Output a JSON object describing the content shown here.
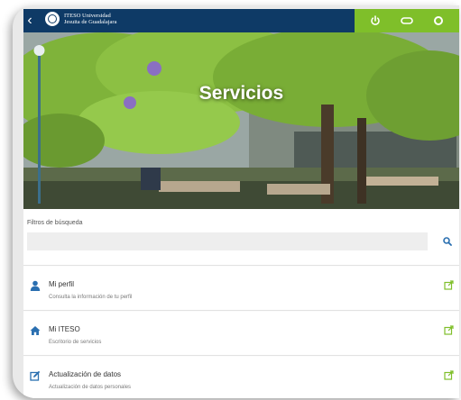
{
  "header": {
    "logo_line1": "ITESO Universidad",
    "logo_line2": "Jesuita de Guadalajara",
    "action_icons": [
      "power-icon",
      "toggle-icon",
      "circle-icon"
    ]
  },
  "hero": {
    "title": "Servicios"
  },
  "filters": {
    "label": "Filtros de búsqueda",
    "value": "",
    "placeholder": ""
  },
  "services": [
    {
      "icon": "user-icon",
      "title": "Mi perfil",
      "subtitle": "Consulta la información de tu perfil"
    },
    {
      "icon": "home-icon",
      "title": "Mi ITESO",
      "subtitle": "Escritorio de servicios"
    },
    {
      "icon": "edit-icon",
      "title": "Actualización de datos",
      "subtitle": "Actualización de datos personales"
    }
  ],
  "colors": {
    "header_bg": "#0e3a66",
    "accent_green": "#7fbf2a",
    "link_blue": "#2a6fb0"
  }
}
